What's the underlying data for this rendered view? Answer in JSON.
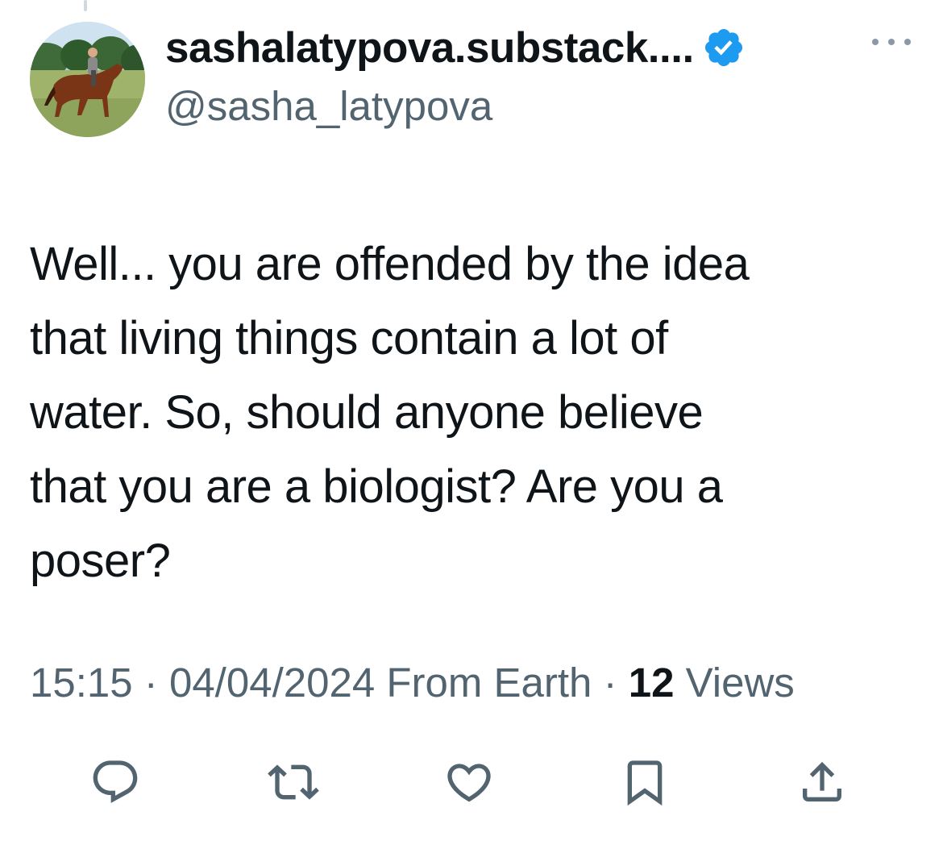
{
  "tweet": {
    "display_name": "sashalatypova.substack....",
    "handle": "@sasha_latypova",
    "text": "Well... you are offended by the idea\nthat living things contain a lot of\nwater.  So, should anyone believe\nthat you are a biologist?  Are you a\nposer?",
    "time": "15:15",
    "date": "04/04/2024",
    "source": "From Earth",
    "separator": "·",
    "views_count": "12",
    "views_label": "Views"
  },
  "icons": {
    "avatar": "avatar-horse-rider",
    "verified": "verified-badge-icon",
    "more": "more-options-icon",
    "reply": "reply-icon",
    "retweet": "retweet-icon",
    "like": "like-icon",
    "bookmark": "bookmark-icon",
    "share": "share-icon"
  },
  "colors": {
    "verified_blue": "#1d9bf0",
    "text_primary": "#0f1419",
    "text_secondary": "#536471",
    "icon_gray": "#536471"
  }
}
